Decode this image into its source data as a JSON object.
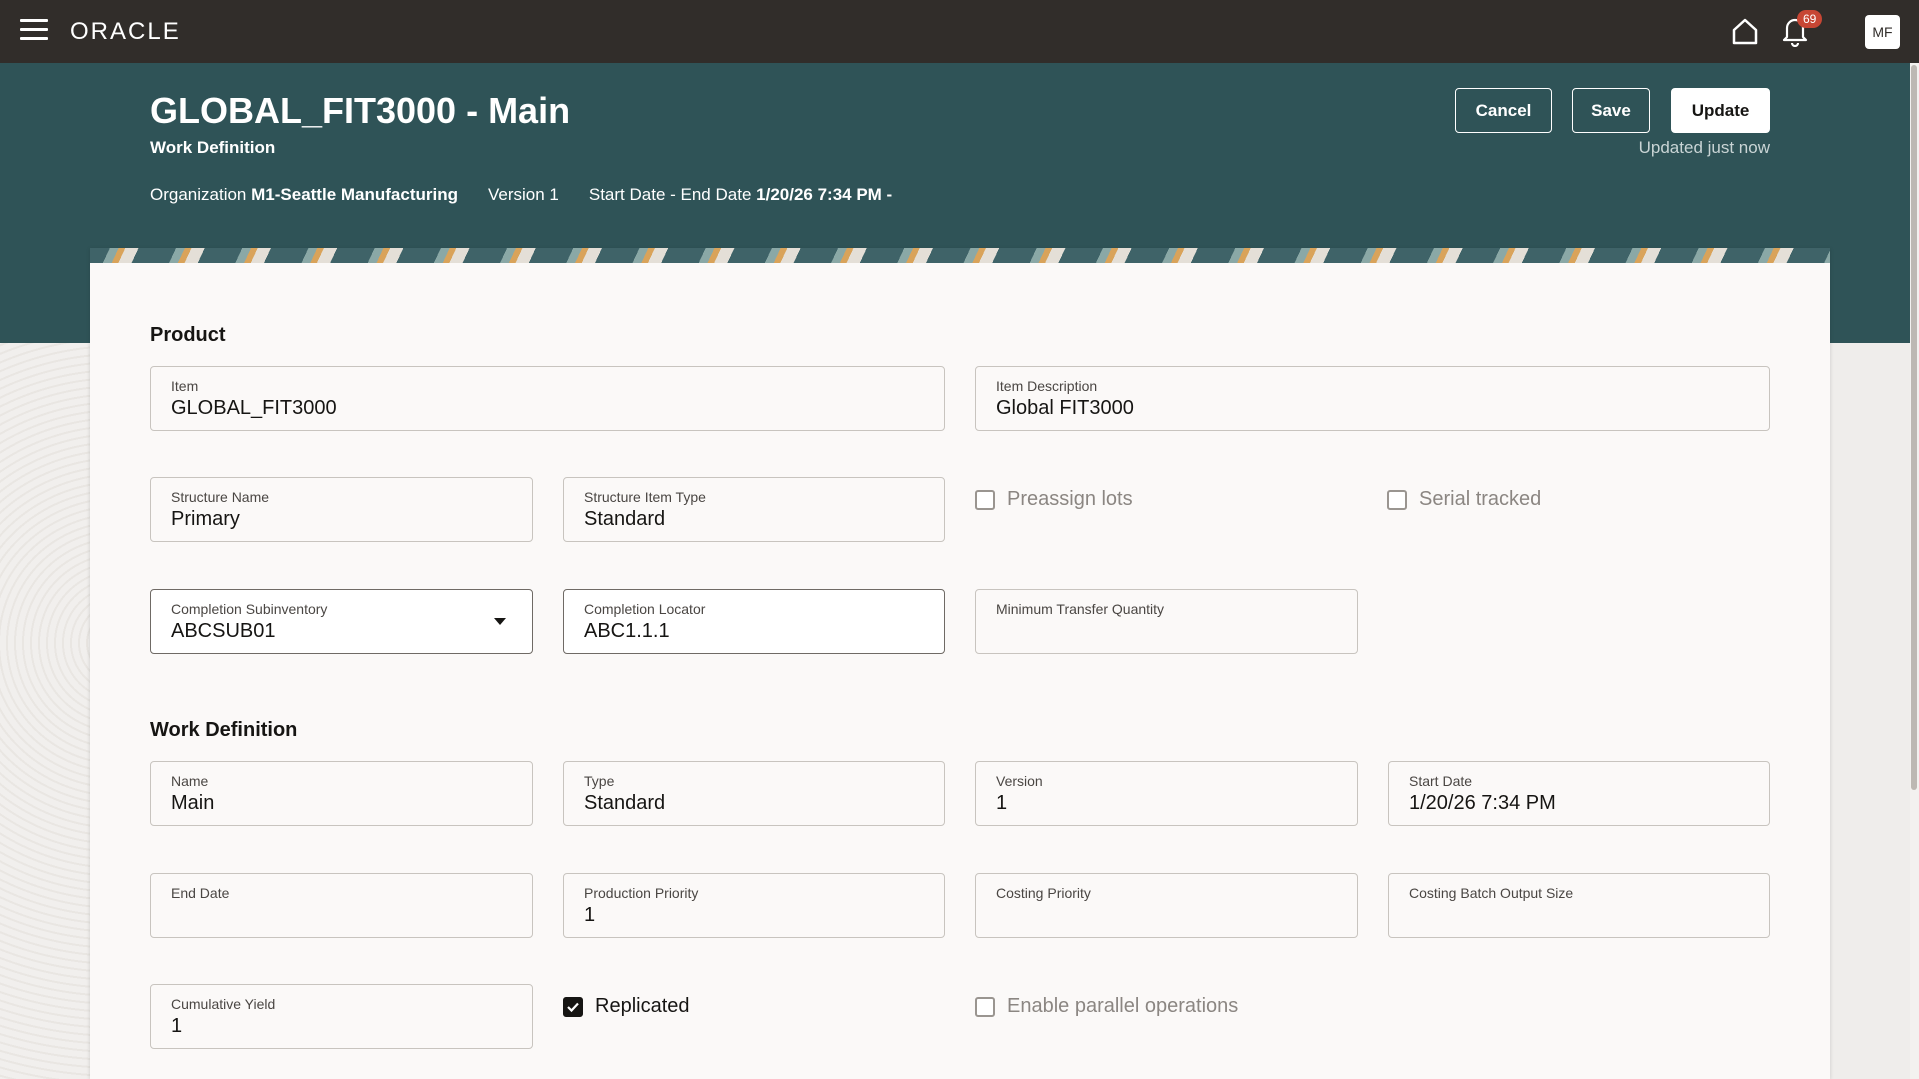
{
  "topbar": {
    "logo": "ORACLE",
    "notifications_count": "69",
    "avatar_initials": "MF"
  },
  "header": {
    "title": "GLOBAL_FIT3000 - Main",
    "subtitle": "Work Definition",
    "organization_label": "Organization",
    "organization_value": "M1-Seattle Manufacturing",
    "version_text": "Version 1",
    "dates_label": "Start Date - End Date",
    "dates_value": "1/20/26 7:34 PM -",
    "cancel_label": "Cancel",
    "save_label": "Save",
    "update_label": "Update",
    "updated_note": "Updated just now"
  },
  "product": {
    "section_title": "Product",
    "item": {
      "label": "Item",
      "value": "GLOBAL_FIT3000"
    },
    "item_description": {
      "label": "Item Description",
      "value": "Global FIT3000"
    },
    "structure_name": {
      "label": "Structure Name",
      "value": "Primary"
    },
    "structure_item_type": {
      "label": "Structure Item Type",
      "value": "Standard"
    },
    "preassign_lots": {
      "label": "Preassign lots",
      "checked": false
    },
    "serial_tracked": {
      "label": "Serial tracked",
      "checked": false
    },
    "completion_subinventory": {
      "label": "Completion Subinventory",
      "value": "ABCSUB01"
    },
    "completion_locator": {
      "label": "Completion Locator",
      "value": "ABC1.1.1"
    },
    "minimum_transfer_quantity": {
      "label": "Minimum Transfer Quantity",
      "value": ""
    }
  },
  "work_definition": {
    "section_title": "Work Definition",
    "name": {
      "label": "Name",
      "value": "Main"
    },
    "type": {
      "label": "Type",
      "value": "Standard"
    },
    "version": {
      "label": "Version",
      "value": "1"
    },
    "start_date": {
      "label": "Start Date",
      "value": "1/20/26 7:34 PM"
    },
    "end_date": {
      "label": "End Date",
      "value": ""
    },
    "production_priority": {
      "label": "Production Priority",
      "value": "1"
    },
    "costing_priority": {
      "label": "Costing Priority",
      "value": ""
    },
    "costing_batch_output_size": {
      "label": "Costing Batch Output Size",
      "value": ""
    },
    "cumulative_yield": {
      "label": "Cumulative Yield",
      "value": "1"
    },
    "replicated": {
      "label": "Replicated",
      "checked": true
    },
    "enable_parallel_operations": {
      "label": "Enable parallel operations",
      "checked": false
    }
  },
  "colors": {
    "topbar": "#312d2a",
    "header_band": "#2f5357",
    "notification_badge": "#c74634"
  }
}
